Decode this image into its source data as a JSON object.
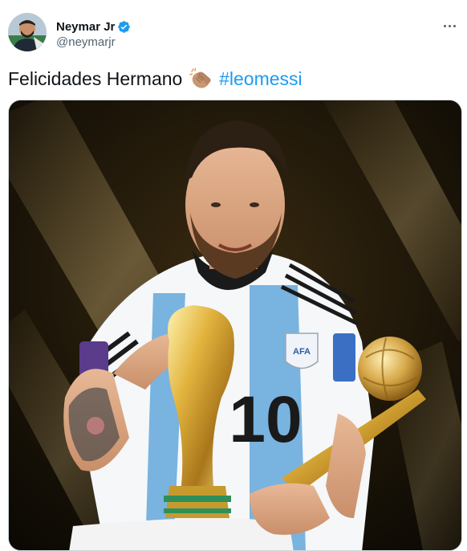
{
  "author": {
    "display_name": "Neymar Jr",
    "handle": "@neymarjr",
    "verified": true,
    "verified_icon": "verified-badge-icon",
    "avatar_icon": "avatar-photo"
  },
  "tweet": {
    "text_prefix": "Felicidades Hermano",
    "emoji": "clapping-hands-emoji",
    "hashtag": "#leomessi"
  },
  "media": {
    "jersey_number": "10",
    "crest_text": "AFA"
  },
  "colors": {
    "link": "#1d9bf0",
    "verified": "#1d9bf0",
    "secondary_text": "#536471",
    "primary_text": "#0f1419"
  },
  "icons": {
    "more": "more-options-icon"
  }
}
